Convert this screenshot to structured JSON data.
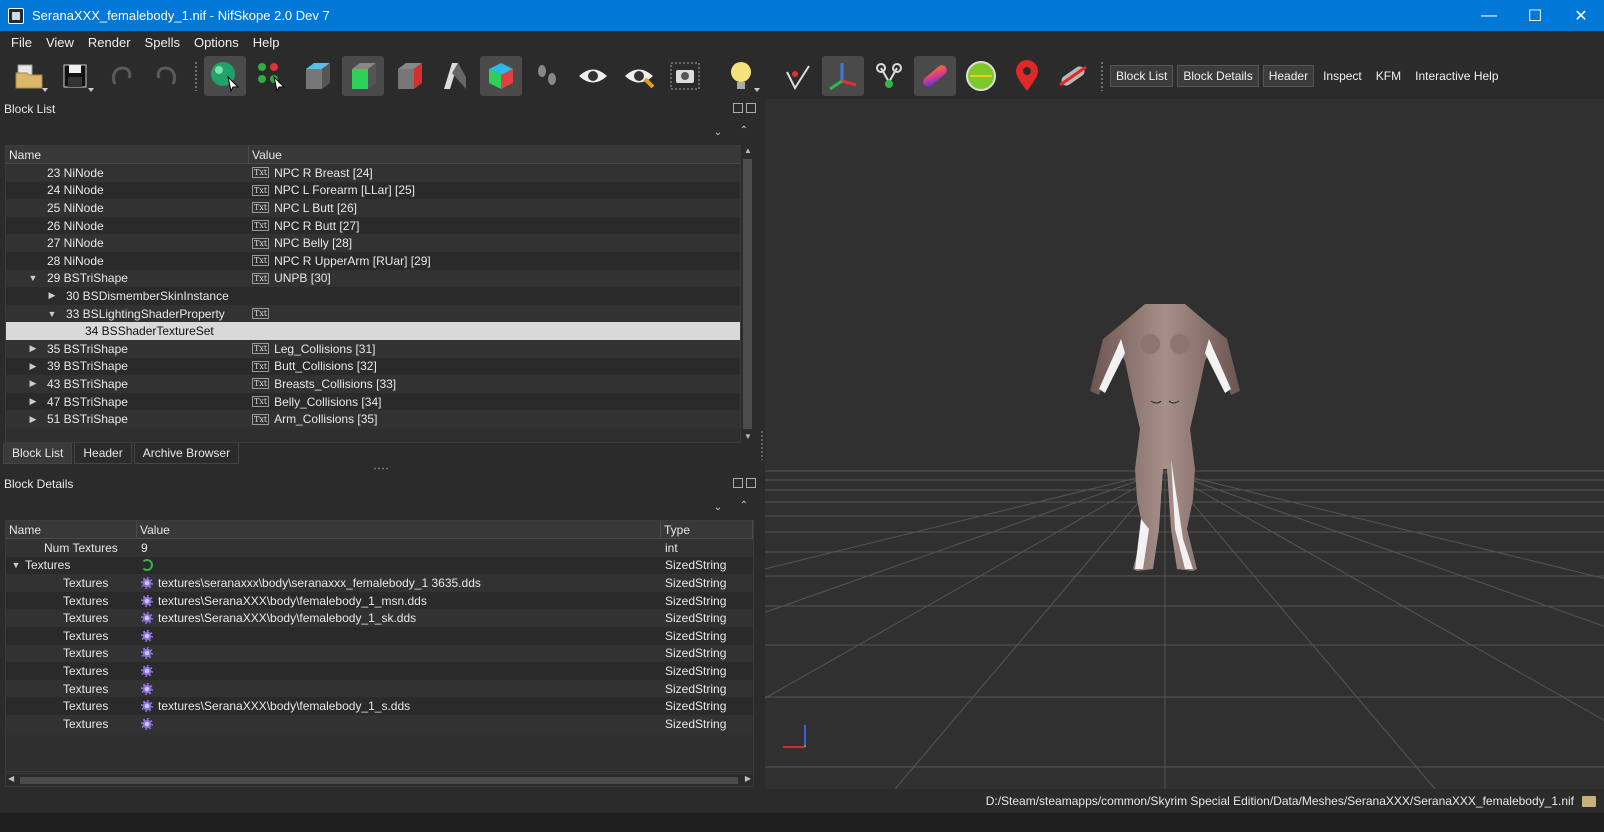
{
  "window": {
    "title": "SeranaXXX_femalebody_1.nif - NifSkope 2.0 Dev 7",
    "minimize": "—",
    "maximize": "☐",
    "close": "✕"
  },
  "menu": [
    "File",
    "View",
    "Render",
    "Spells",
    "Options",
    "Help"
  ],
  "toolbar": {
    "text_buttons": [
      "Block List",
      "Block Details",
      "Header",
      "Inspect",
      "KFM",
      "Interactive Help"
    ]
  },
  "block_list": {
    "title": "Block List",
    "columns": [
      "Name",
      "Value"
    ],
    "rows": [
      {
        "name": "23 NiNode",
        "value": "NPC R Breast [24]",
        "arrow": "",
        "indent": 0,
        "txt": true
      },
      {
        "name": "24 NiNode",
        "value": "NPC L Forearm [LLar] [25]",
        "arrow": "",
        "indent": 0,
        "txt": true
      },
      {
        "name": "25 NiNode",
        "value": "NPC L Butt [26]",
        "arrow": "",
        "indent": 0,
        "txt": true
      },
      {
        "name": "26 NiNode",
        "value": "NPC R Butt [27]",
        "arrow": "",
        "indent": 0,
        "txt": true
      },
      {
        "name": "27 NiNode",
        "value": "NPC Belly [28]",
        "arrow": "",
        "indent": 0,
        "txt": true
      },
      {
        "name": "28 NiNode",
        "value": "NPC R UpperArm [RUar] [29]",
        "arrow": "",
        "indent": 0,
        "txt": true
      },
      {
        "name": "29 BSTriShape",
        "value": "UNPB [30]",
        "arrow": "▼",
        "indent": 0,
        "txt": true
      },
      {
        "name": "30 BSDismemberSkinInstance",
        "value": "",
        "arrow": "▶",
        "indent": 1,
        "txt": false
      },
      {
        "name": "33 BSLightingShaderProperty",
        "value": "",
        "arrow": "▼",
        "indent": 1,
        "txt": true
      },
      {
        "name": "34 BSShaderTextureSet",
        "value": "",
        "arrow": "",
        "indent": 2,
        "txt": false
      },
      {
        "name": "35 BSTriShape",
        "value": "Leg_Collisions [31]",
        "arrow": "▶",
        "indent": 0,
        "txt": true
      },
      {
        "name": "39 BSTriShape",
        "value": "Butt_Collisions [32]",
        "arrow": "▶",
        "indent": 0,
        "txt": true
      },
      {
        "name": "43 BSTriShape",
        "value": "Breasts_Collisions [33]",
        "arrow": "▶",
        "indent": 0,
        "txt": true
      },
      {
        "name": "47 BSTriShape",
        "value": "Belly_Collisions [34]",
        "arrow": "▶",
        "indent": 0,
        "txt": true
      },
      {
        "name": "51 BSTriShape",
        "value": "Arm_Collisions [35]",
        "arrow": "▶",
        "indent": 0,
        "txt": true
      }
    ],
    "selected_index": 9,
    "txt_icon_label": "Txt"
  },
  "tabs": [
    "Block List",
    "Header",
    "Archive Browser"
  ],
  "block_details": {
    "title": "Block Details",
    "columns": [
      "Name",
      "Value",
      "Type"
    ],
    "rows": [
      {
        "name": "Num Textures",
        "value": "9",
        "type": "int",
        "arrow": "",
        "icon": "",
        "indent": 1
      },
      {
        "name": "Textures",
        "value": "",
        "type": "SizedString",
        "arrow": "▼",
        "icon": "refresh",
        "indent": 0
      },
      {
        "name": "Textures",
        "value": "textures\\seranaxxx\\body\\seranaxxx_femalebody_1 3635.dds",
        "type": "SizedString",
        "arrow": "",
        "icon": "gear",
        "indent": 2
      },
      {
        "name": "Textures",
        "value": "textures\\SeranaXXX\\body\\femalebody_1_msn.dds",
        "type": "SizedString",
        "arrow": "",
        "icon": "gear",
        "indent": 2
      },
      {
        "name": "Textures",
        "value": "textures\\SeranaXXX\\body\\femalebody_1_sk.dds",
        "type": "SizedString",
        "arrow": "",
        "icon": "gear",
        "indent": 2
      },
      {
        "name": "Textures",
        "value": "",
        "type": "SizedString",
        "arrow": "",
        "icon": "gear",
        "indent": 2
      },
      {
        "name": "Textures",
        "value": "",
        "type": "SizedString",
        "arrow": "",
        "icon": "gear",
        "indent": 2
      },
      {
        "name": "Textures",
        "value": "",
        "type": "SizedString",
        "arrow": "",
        "icon": "gear",
        "indent": 2
      },
      {
        "name": "Textures",
        "value": "",
        "type": "SizedString",
        "arrow": "",
        "icon": "gear",
        "indent": 2
      },
      {
        "name": "Textures",
        "value": "textures\\SeranaXXX\\body\\femalebody_1_s.dds",
        "type": "SizedString",
        "arrow": "",
        "icon": "gear",
        "indent": 2
      },
      {
        "name": "Textures",
        "value": "",
        "type": "SizedString",
        "arrow": "",
        "icon": "gear",
        "indent": 2
      }
    ]
  },
  "status": {
    "path": "D:/Steam/steamapps/common/Skyrim Special Edition/Data/Meshes/SeranaXXX/SeranaXXX_femalebody_1.nif"
  },
  "colors": {
    "titlebar": "#0078d7",
    "background": "#2b2b2b",
    "selection": "#d9d9d9",
    "grid": "#5a5a5a"
  }
}
